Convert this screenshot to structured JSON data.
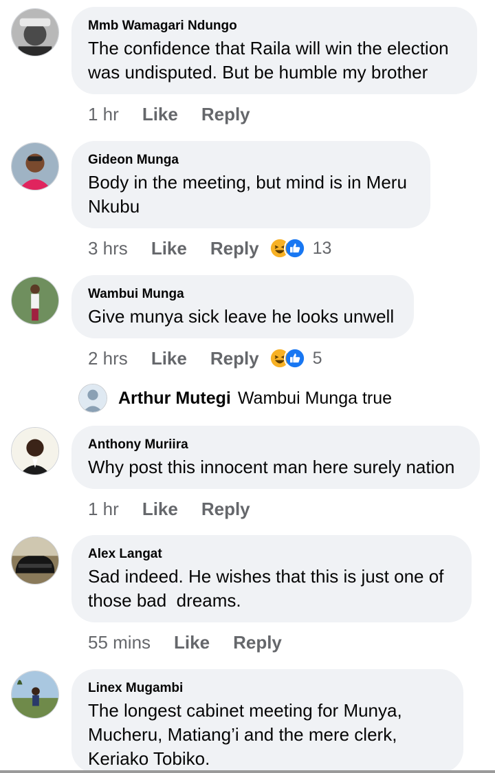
{
  "comments": [
    {
      "author": "Mmb Wamagari Ndungo",
      "lines": [
        "The confidence that Raila will win the election",
        "was undisputed. But be humble my brother"
      ],
      "time": "1 hr",
      "like": "Like",
      "reply": "Reply"
    },
    {
      "author": "Gideon Munga",
      "lines": [
        "Body in the meeting, but mind is in Meru",
        "Nkubu"
      ],
      "time": "3 hrs",
      "like": "Like",
      "reply": "Reply",
      "reaction_count": "13"
    },
    {
      "author": "Wambui Munga",
      "lines": [
        "Give munya sick leave he looks unwell"
      ],
      "time": "2 hrs",
      "like": "Like",
      "reply": "Reply",
      "reaction_count": "5"
    },
    {
      "author": "Anthony Muriira",
      "lines": [
        "Why post this innocent man here surely nation"
      ],
      "time": "1 hr",
      "like": "Like",
      "reply": "Reply"
    },
    {
      "author": "Alex Langat",
      "lines": [
        "Sad indeed. He wishes that this is just one of",
        "those bad  dreams."
      ],
      "time": "55 mins",
      "like": "Like",
      "reply": "Reply"
    },
    {
      "author": "Linex Mugambi",
      "lines": [
        "The longest cabinet meeting for Munya,",
        "Mucheru, Matiang’i and the mere clerk,",
        "Keriako Tobiko."
      ]
    }
  ],
  "reply": {
    "author": "Arthur Mutegi",
    "text": "Wambui Munga true"
  },
  "colors": {
    "bubble": "#f0f2f5",
    "meta_text": "#65676b",
    "like_blue": "#1877f2",
    "haha_yellow": "#f7b125"
  },
  "icons": [
    "haha-reaction-icon",
    "like-reaction-icon"
  ]
}
